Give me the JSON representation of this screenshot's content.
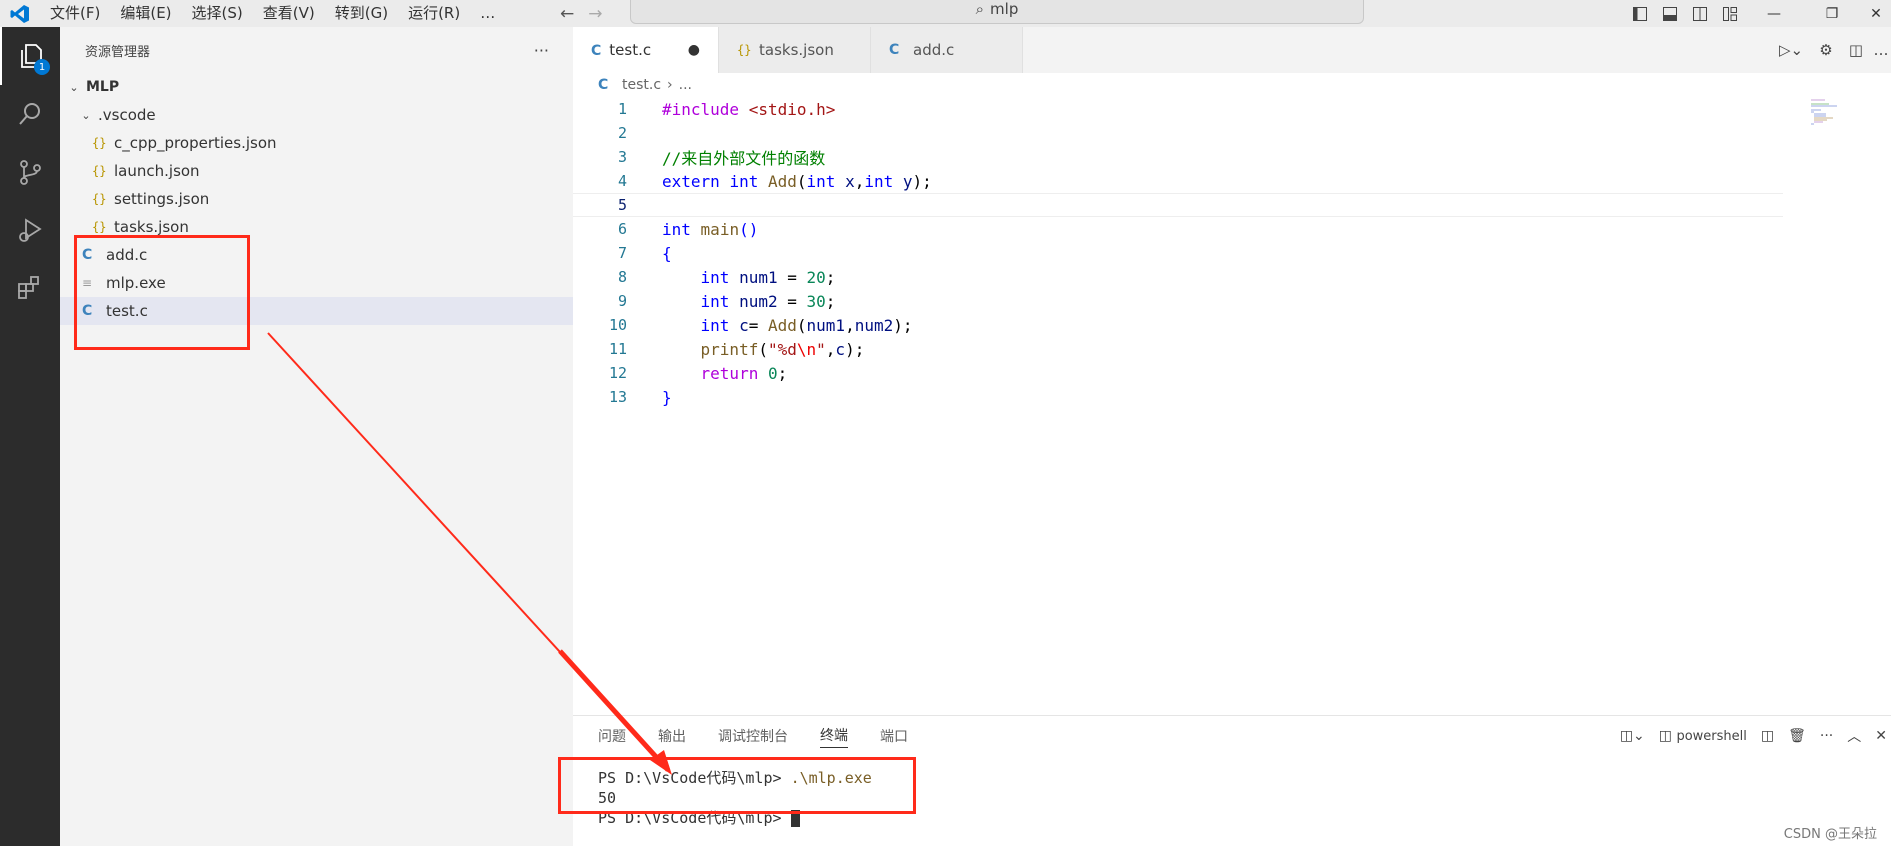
{
  "titlebar": {
    "menus": [
      "文件(F)",
      "编辑(E)",
      "选择(S)",
      "查看(V)",
      "转到(G)",
      "运行(R)",
      "…"
    ],
    "search": "mlp"
  },
  "activity": {
    "badge": "1",
    "items": [
      "explorer-icon",
      "search-icon",
      "source-control-icon",
      "run-debug-icon",
      "extensions-icon"
    ]
  },
  "sidebar": {
    "title": "资源管理器",
    "more": "···",
    "root": "MLP",
    "folder": ".vscode",
    "vscode_files": [
      "c_cpp_properties.json",
      "launch.json",
      "settings.json",
      "tasks.json"
    ],
    "files": [
      "add.c",
      "mlp.exe",
      "test.c"
    ]
  },
  "tabs": [
    {
      "label": "test.c",
      "type": "c",
      "dirty": "●"
    },
    {
      "label": "tasks.json",
      "type": "json"
    },
    {
      "label": "add.c",
      "type": "c"
    }
  ],
  "breadcrumb": {
    "file": "test.c",
    "rest": "..."
  },
  "panel": {
    "tabs": [
      "问题",
      "输出",
      "调试控制台",
      "终端",
      "端口"
    ],
    "active_tab": "终端",
    "shell": "powershell",
    "terminal": {
      "prompt1": "PS D:\\VsCode代码\\mlp> ",
      "cmd1": ".\\mlp.exe",
      "output": "50",
      "prompt2": "PS D:\\VsCode代码\\mlp> "
    }
  },
  "watermark": "CSDN @王朵拉",
  "colors": {
    "annotation": "#ff2a1a",
    "accent": "#0078d4"
  }
}
